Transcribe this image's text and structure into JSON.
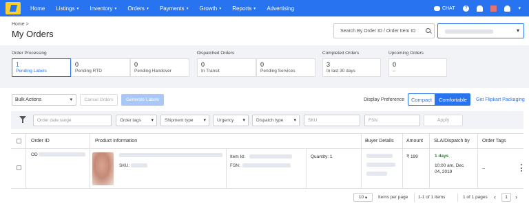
{
  "nav": {
    "items": [
      {
        "label": "Home",
        "dropdown": false
      },
      {
        "label": "Listings",
        "dropdown": true
      },
      {
        "label": "Inventory",
        "dropdown": true
      },
      {
        "label": "Orders",
        "dropdown": true
      },
      {
        "label": "Payments",
        "dropdown": true
      },
      {
        "label": "Growth",
        "dropdown": true
      },
      {
        "label": "Reports",
        "dropdown": true
      },
      {
        "label": "Advertising",
        "dropdown": false
      }
    ],
    "chat_label": "CHAT",
    "help_icon": "?",
    "brand_color": "#2874f0"
  },
  "header": {
    "breadcrumb": "Home >",
    "title": "My Orders",
    "search_placeholder": "Search By Order ID / Order Item ID"
  },
  "status_groups": {
    "processing_label": "Order Processing",
    "dispatched_label": "Dispatched Orders",
    "completed_label": "Completed Orders",
    "upcoming_label": "Upcoming Orders",
    "cards": [
      {
        "num": "1",
        "label": "Pending Labels"
      },
      {
        "num": "0",
        "label": "Pending RTD"
      },
      {
        "num": "0",
        "label": "Pending Handover"
      },
      {
        "num": "0",
        "label": "In Transit"
      },
      {
        "num": "0",
        "label": "Pending Services"
      },
      {
        "num": "3",
        "label": "In last 30 days"
      },
      {
        "num": "0",
        "label": "--"
      }
    ]
  },
  "toolbar": {
    "bulk_actions": "Bulk Actions",
    "cancel_orders": "Cancel Orders",
    "generate_labels": "Generate Labels",
    "display_preference": "Display Preference",
    "compact": "Compact",
    "comfortable": "Comfortable",
    "get_packaging": "Get Flipkart Packaging"
  },
  "filters": {
    "order_date_placeholder": "Order date range",
    "order_tags": "Order tags",
    "shipment_type": "Shipment type",
    "urgency": "Urgency",
    "dispatch_type": "Dispatch type",
    "sku_placeholder": "SKU",
    "fsn_placeholder": "FSN",
    "apply": "Apply"
  },
  "table": {
    "headers": [
      "Order ID",
      "Product Information",
      "Buyer Details",
      "Amount",
      "SLA/Dispatch by",
      "Order Tags"
    ],
    "row": {
      "order_id_prefix": "OD",
      "sku_label": "SKU:",
      "item_id_label": "Item Id:",
      "fsn_label": "FSN:",
      "quantity": "Quantity: 1",
      "amount": "₹ 199",
      "sla_days": "1 days",
      "dispatch_time": "10:00 am, Dec",
      "dispatch_date": "04, 2019",
      "order_tags": "--"
    }
  },
  "pager": {
    "page_size": "10",
    "items_per_page": "Items per page",
    "range": "1-1 of 1 items",
    "pages": "1 of 1 pages",
    "current_page": "1"
  }
}
